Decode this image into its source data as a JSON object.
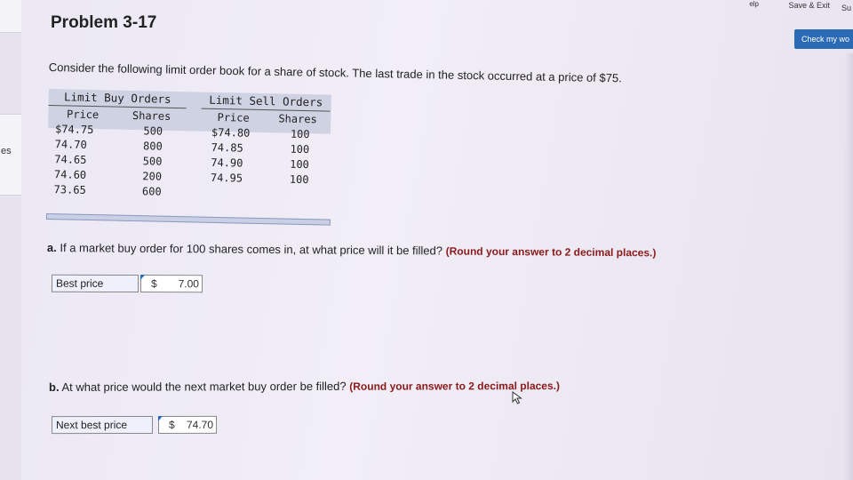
{
  "header": {
    "help_stub": "elp",
    "save_exit": "Save & Exit",
    "submit_stub": "Su",
    "check_button": "Check my wo"
  },
  "sidebar": {
    "label_stub": "es"
  },
  "problem": {
    "title": "Problem 3-17",
    "intro": "Consider the following limit order book for a share of stock. The last trade in the stock occurred at a price of $75."
  },
  "order_book": {
    "buy": {
      "title": "Limit Buy Orders",
      "price_header": "Price",
      "shares_header": "Shares",
      "rows": [
        {
          "price": "$74.75",
          "shares": "500"
        },
        {
          "price": "74.70",
          "shares": "800"
        },
        {
          "price": "74.65",
          "shares": "500"
        },
        {
          "price": "74.60",
          "shares": "200"
        },
        {
          "price": "73.65",
          "shares": "600"
        }
      ]
    },
    "sell": {
      "title": "Limit Sell Orders",
      "price_header": "Price",
      "shares_header": "Shares",
      "rows": [
        {
          "price": "$74.80",
          "shares": "100"
        },
        {
          "price": "74.85",
          "shares": "100"
        },
        {
          "price": "74.90",
          "shares": "100"
        },
        {
          "price": "74.95",
          "shares": "100"
        }
      ]
    }
  },
  "question_a": {
    "letter": "a.",
    "text": "If a market buy order for 100 shares comes in, at what price will it be filled?",
    "note": "(Round your answer to 2 decimal places.)",
    "answer_label": "Best price",
    "currency": "$",
    "value": "7.00"
  },
  "question_b": {
    "letter": "b.",
    "text": "At what price would the next market buy order be filled?",
    "note": "(Round your answer to 2 decimal places.)",
    "answer_label": "Next best price",
    "currency": "$",
    "value": "74.70"
  },
  "colors": {
    "accent": "#2b6bb5",
    "note": "#8b1a1a",
    "table_header_bg": "#cfd2e3"
  }
}
